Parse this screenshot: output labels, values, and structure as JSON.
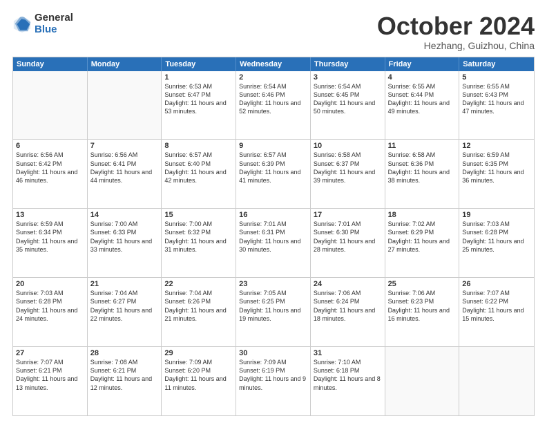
{
  "logo": {
    "general": "General",
    "blue": "Blue"
  },
  "title": "October 2024",
  "location": "Hezhang, Guizhou, China",
  "weekdays": [
    "Sunday",
    "Monday",
    "Tuesday",
    "Wednesday",
    "Thursday",
    "Friday",
    "Saturday"
  ],
  "weeks": [
    [
      {
        "day": "",
        "text": ""
      },
      {
        "day": "",
        "text": ""
      },
      {
        "day": "1",
        "text": "Sunrise: 6:53 AM\nSunset: 6:47 PM\nDaylight: 11 hours and 53 minutes."
      },
      {
        "day": "2",
        "text": "Sunrise: 6:54 AM\nSunset: 6:46 PM\nDaylight: 11 hours and 52 minutes."
      },
      {
        "day": "3",
        "text": "Sunrise: 6:54 AM\nSunset: 6:45 PM\nDaylight: 11 hours and 50 minutes."
      },
      {
        "day": "4",
        "text": "Sunrise: 6:55 AM\nSunset: 6:44 PM\nDaylight: 11 hours and 49 minutes."
      },
      {
        "day": "5",
        "text": "Sunrise: 6:55 AM\nSunset: 6:43 PM\nDaylight: 11 hours and 47 minutes."
      }
    ],
    [
      {
        "day": "6",
        "text": "Sunrise: 6:56 AM\nSunset: 6:42 PM\nDaylight: 11 hours and 46 minutes."
      },
      {
        "day": "7",
        "text": "Sunrise: 6:56 AM\nSunset: 6:41 PM\nDaylight: 11 hours and 44 minutes."
      },
      {
        "day": "8",
        "text": "Sunrise: 6:57 AM\nSunset: 6:40 PM\nDaylight: 11 hours and 42 minutes."
      },
      {
        "day": "9",
        "text": "Sunrise: 6:57 AM\nSunset: 6:39 PM\nDaylight: 11 hours and 41 minutes."
      },
      {
        "day": "10",
        "text": "Sunrise: 6:58 AM\nSunset: 6:37 PM\nDaylight: 11 hours and 39 minutes."
      },
      {
        "day": "11",
        "text": "Sunrise: 6:58 AM\nSunset: 6:36 PM\nDaylight: 11 hours and 38 minutes."
      },
      {
        "day": "12",
        "text": "Sunrise: 6:59 AM\nSunset: 6:35 PM\nDaylight: 11 hours and 36 minutes."
      }
    ],
    [
      {
        "day": "13",
        "text": "Sunrise: 6:59 AM\nSunset: 6:34 PM\nDaylight: 11 hours and 35 minutes."
      },
      {
        "day": "14",
        "text": "Sunrise: 7:00 AM\nSunset: 6:33 PM\nDaylight: 11 hours and 33 minutes."
      },
      {
        "day": "15",
        "text": "Sunrise: 7:00 AM\nSunset: 6:32 PM\nDaylight: 11 hours and 31 minutes."
      },
      {
        "day": "16",
        "text": "Sunrise: 7:01 AM\nSunset: 6:31 PM\nDaylight: 11 hours and 30 minutes."
      },
      {
        "day": "17",
        "text": "Sunrise: 7:01 AM\nSunset: 6:30 PM\nDaylight: 11 hours and 28 minutes."
      },
      {
        "day": "18",
        "text": "Sunrise: 7:02 AM\nSunset: 6:29 PM\nDaylight: 11 hours and 27 minutes."
      },
      {
        "day": "19",
        "text": "Sunrise: 7:03 AM\nSunset: 6:28 PM\nDaylight: 11 hours and 25 minutes."
      }
    ],
    [
      {
        "day": "20",
        "text": "Sunrise: 7:03 AM\nSunset: 6:28 PM\nDaylight: 11 hours and 24 minutes."
      },
      {
        "day": "21",
        "text": "Sunrise: 7:04 AM\nSunset: 6:27 PM\nDaylight: 11 hours and 22 minutes."
      },
      {
        "day": "22",
        "text": "Sunrise: 7:04 AM\nSunset: 6:26 PM\nDaylight: 11 hours and 21 minutes."
      },
      {
        "day": "23",
        "text": "Sunrise: 7:05 AM\nSunset: 6:25 PM\nDaylight: 11 hours and 19 minutes."
      },
      {
        "day": "24",
        "text": "Sunrise: 7:06 AM\nSunset: 6:24 PM\nDaylight: 11 hours and 18 minutes."
      },
      {
        "day": "25",
        "text": "Sunrise: 7:06 AM\nSunset: 6:23 PM\nDaylight: 11 hours and 16 minutes."
      },
      {
        "day": "26",
        "text": "Sunrise: 7:07 AM\nSunset: 6:22 PM\nDaylight: 11 hours and 15 minutes."
      }
    ],
    [
      {
        "day": "27",
        "text": "Sunrise: 7:07 AM\nSunset: 6:21 PM\nDaylight: 11 hours and 13 minutes."
      },
      {
        "day": "28",
        "text": "Sunrise: 7:08 AM\nSunset: 6:21 PM\nDaylight: 11 hours and 12 minutes."
      },
      {
        "day": "29",
        "text": "Sunrise: 7:09 AM\nSunset: 6:20 PM\nDaylight: 11 hours and 11 minutes."
      },
      {
        "day": "30",
        "text": "Sunrise: 7:09 AM\nSunset: 6:19 PM\nDaylight: 11 hours and 9 minutes."
      },
      {
        "day": "31",
        "text": "Sunrise: 7:10 AM\nSunset: 6:18 PM\nDaylight: 11 hours and 8 minutes."
      },
      {
        "day": "",
        "text": ""
      },
      {
        "day": "",
        "text": ""
      }
    ]
  ]
}
